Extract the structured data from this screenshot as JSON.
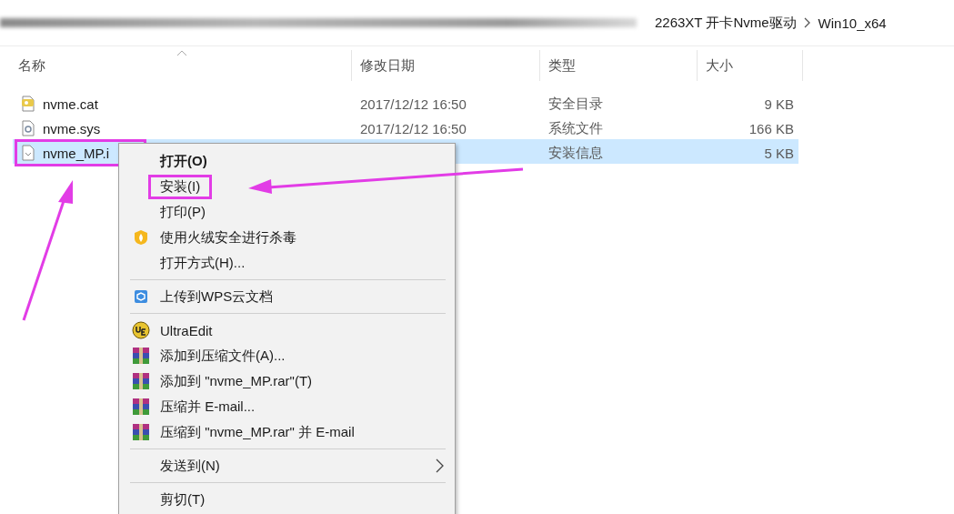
{
  "address_bar": {
    "path": [
      {
        "label": "2263XT 开卡Nvme驱动"
      },
      {
        "label": "Win10_x64"
      }
    ]
  },
  "columns": [
    {
      "label": "名称",
      "sorted": true
    },
    {
      "label": "修改日期",
      "sorted": false
    },
    {
      "label": "类型",
      "sorted": false
    },
    {
      "label": "大小",
      "sorted": false
    }
  ],
  "files": [
    {
      "name": "nvme.cat",
      "kind": "catalog",
      "date": "2017/12/12 16:50",
      "type": "安全目录",
      "size": "9 KB",
      "selected": false,
      "annotated": false
    },
    {
      "name": "nvme.sys",
      "kind": "system",
      "date": "2017/12/12 16:50",
      "type": "系统文件",
      "size": "166 KB",
      "selected": false,
      "annotated": false
    },
    {
      "name": "nvme_MP.i",
      "kind": "setup",
      "type": "安装信息",
      "size": "5 KB",
      "selected": true,
      "annotated": true
    }
  ],
  "context_menu": {
    "items": [
      {
        "kind": "plain",
        "label": "打开(O)",
        "bold": true,
        "annotated": false
      },
      {
        "kind": "plain",
        "label": "安装(I)",
        "bold": false,
        "annotated": true
      },
      {
        "kind": "plain",
        "label": "打印(P)",
        "bold": false,
        "annotated": false
      },
      {
        "kind": "shield",
        "label": "使用火绒安全进行杀毒",
        "bold": false,
        "annotated": false
      },
      {
        "kind": "plain",
        "label": "打开方式(H)...",
        "bold": false,
        "annotated": false
      },
      {
        "kind": "separator"
      },
      {
        "kind": "cube",
        "label": "上传到WPS云文档",
        "bold": false,
        "annotated": false
      },
      {
        "kind": "separator"
      },
      {
        "kind": "ue",
        "label": "UltraEdit",
        "bold": false,
        "annotated": false
      },
      {
        "kind": "archive",
        "label": "添加到压缩文件(A)...",
        "bold": false,
        "annotated": false
      },
      {
        "kind": "archive",
        "label": "添加到 \"nvme_MP.rar\"(T)",
        "bold": false,
        "annotated": false
      },
      {
        "kind": "archive",
        "label": "压缩并 E-mail...",
        "bold": false,
        "annotated": false
      },
      {
        "kind": "archive",
        "label": "压缩到 \"nvme_MP.rar\" 并 E-mail",
        "bold": false,
        "annotated": false
      },
      {
        "kind": "separator"
      },
      {
        "kind": "plain",
        "label": "发送到(N)",
        "bold": false,
        "annotated": false,
        "submenu": true
      },
      {
        "kind": "separator"
      },
      {
        "kind": "plain",
        "label": "剪切(T)",
        "bold": false,
        "annotated": false
      }
    ]
  }
}
